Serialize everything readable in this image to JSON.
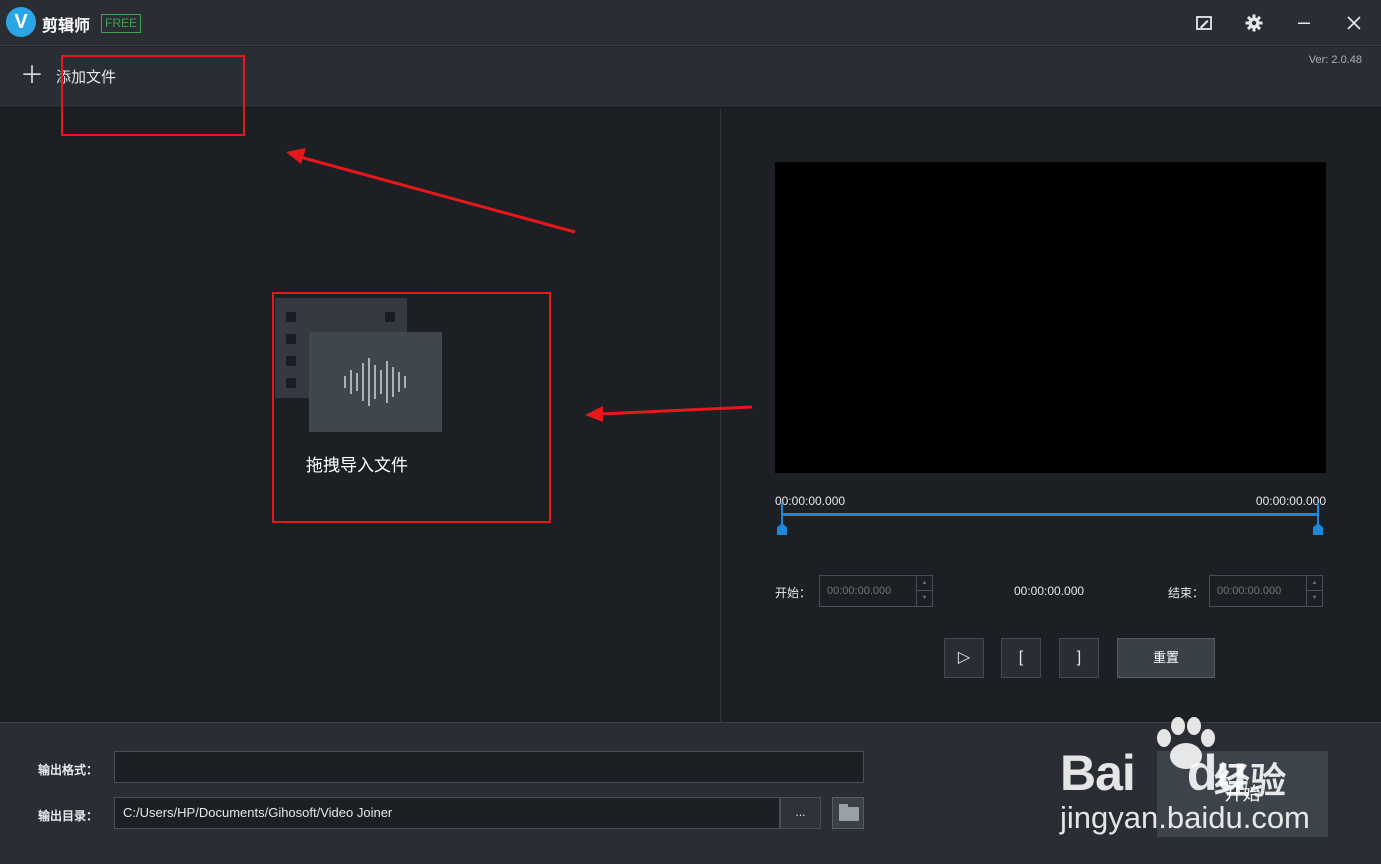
{
  "window": {
    "logo_letter": "V",
    "title": "剪辑师",
    "badge": "FREE",
    "buttons": {
      "edit": "edit-icon",
      "settings": "gear-icon",
      "minimize": "minimize-icon",
      "close": "close-icon"
    }
  },
  "toolbar": {
    "add_file_label": "添加文件",
    "version": "Ver: 2.0.48"
  },
  "drop_area": {
    "label": "拖拽导入文件",
    "icon": "film-audio-icon"
  },
  "preview": {
    "time_start": "00:00:00.000",
    "time_end": "00:00:00.000",
    "start_label": "开始：",
    "start_placeholder": "00:00:00.000",
    "current_time": "00:00:00.000",
    "end_label": "结束：",
    "end_placeholder": "00:00:00.000",
    "controls": {
      "play": "▷",
      "mark_in": "[",
      "mark_out": "]",
      "reset": "重置"
    }
  },
  "output": {
    "format_label": "输出格式：",
    "format_value": "",
    "dir_label": "输出目录：",
    "dir_value": "C:/Users/HP/Documents/Gihosoft/Video Joiner",
    "browse_label": "...",
    "start_label": "开始"
  },
  "watermark": {
    "brand": "Bai",
    "brand_suffix": "du",
    "service": "经验",
    "url": "jingyan.baidu.com"
  },
  "colors": {
    "accent_blue": "#1e88d8",
    "annotation_red": "#e8171c",
    "free_green": "#3fa34d"
  }
}
